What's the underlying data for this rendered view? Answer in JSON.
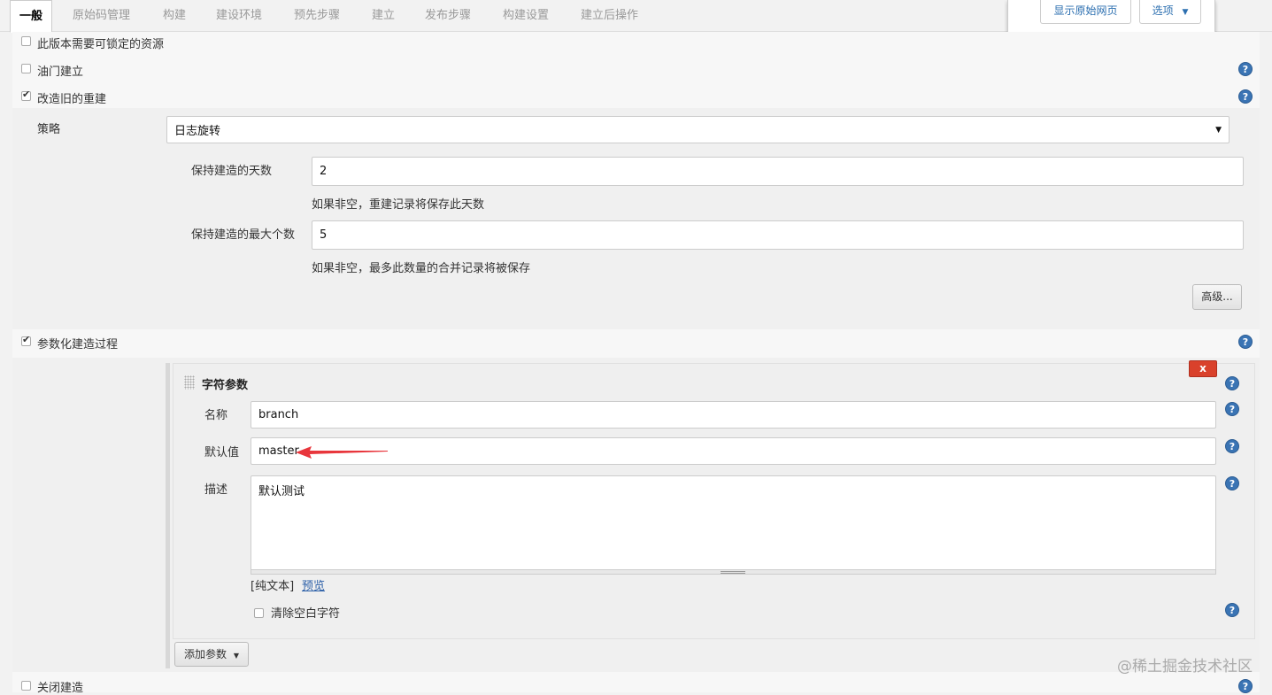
{
  "tabs": [
    {
      "label": "一般",
      "active": true
    },
    {
      "label": "原始码管理"
    },
    {
      "label": "构建"
    },
    {
      "label": "建设环境"
    },
    {
      "label": "预先步骤"
    },
    {
      "label": "建立"
    },
    {
      "label": "发布步骤"
    },
    {
      "label": "构建设置"
    },
    {
      "label": "建立后操作"
    }
  ],
  "popup": {
    "show_raw": "显示原始网页",
    "options": "选项"
  },
  "options": {
    "lockable": "此版本需要可锁定的资源",
    "throttle": "油门建立",
    "discard_old": "改造旧的重建",
    "parameterized": "参数化建造过程",
    "disable": "关闭建造"
  },
  "discard": {
    "strategy_label": "策略",
    "strategy_value": "日志旋转",
    "days_label": "保持建造的天数",
    "days_value": "2",
    "days_note": "如果非空，重建记录将保存此天数",
    "max_label": "保持建造的最大个数",
    "max_value": "5",
    "max_note": "如果非空，最多此数量的合并记录将被保存",
    "advanced": "高级..."
  },
  "param": {
    "close": "x",
    "title": "字符参数",
    "name_label": "名称",
    "name_value": "branch",
    "default_label": "默认值",
    "default_value": "master",
    "desc_label": "描述",
    "desc_value": "默认测试",
    "plain_text": "[纯文本]",
    "preview": "预览",
    "trim": "清除空白字符",
    "add": "添加参数"
  },
  "help_glyph": "?",
  "watermark": "@稀土掘金技术社区",
  "colors": {
    "accent": "#3a74b4",
    "close": "#d9412b",
    "arrow": "#e8363c"
  }
}
